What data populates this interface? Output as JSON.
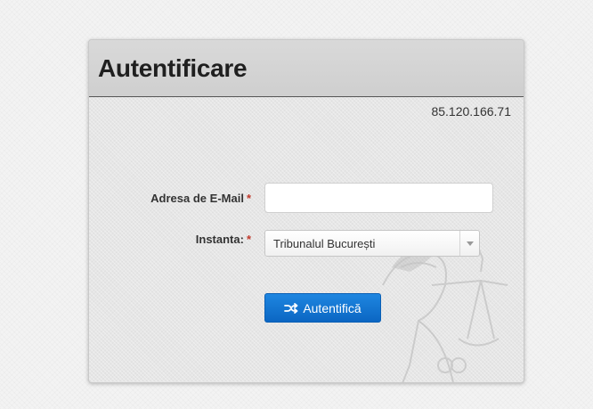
{
  "panel": {
    "title": "Autentificare",
    "ip_address": "85.120.166.71"
  },
  "form": {
    "email": {
      "label": "Adresa de E-Mail",
      "required_marker": "*",
      "value": "",
      "placeholder": ""
    },
    "instanta": {
      "label": "Instanta:",
      "required_marker": "*",
      "selected": "Tribunalul București"
    },
    "submit": {
      "label": "Autentifică",
      "icon": "shuffle-icon"
    }
  },
  "colors": {
    "button_blue": "#1778d3",
    "required_red": "#c0392b",
    "header_gray": "#d4d4d4"
  }
}
